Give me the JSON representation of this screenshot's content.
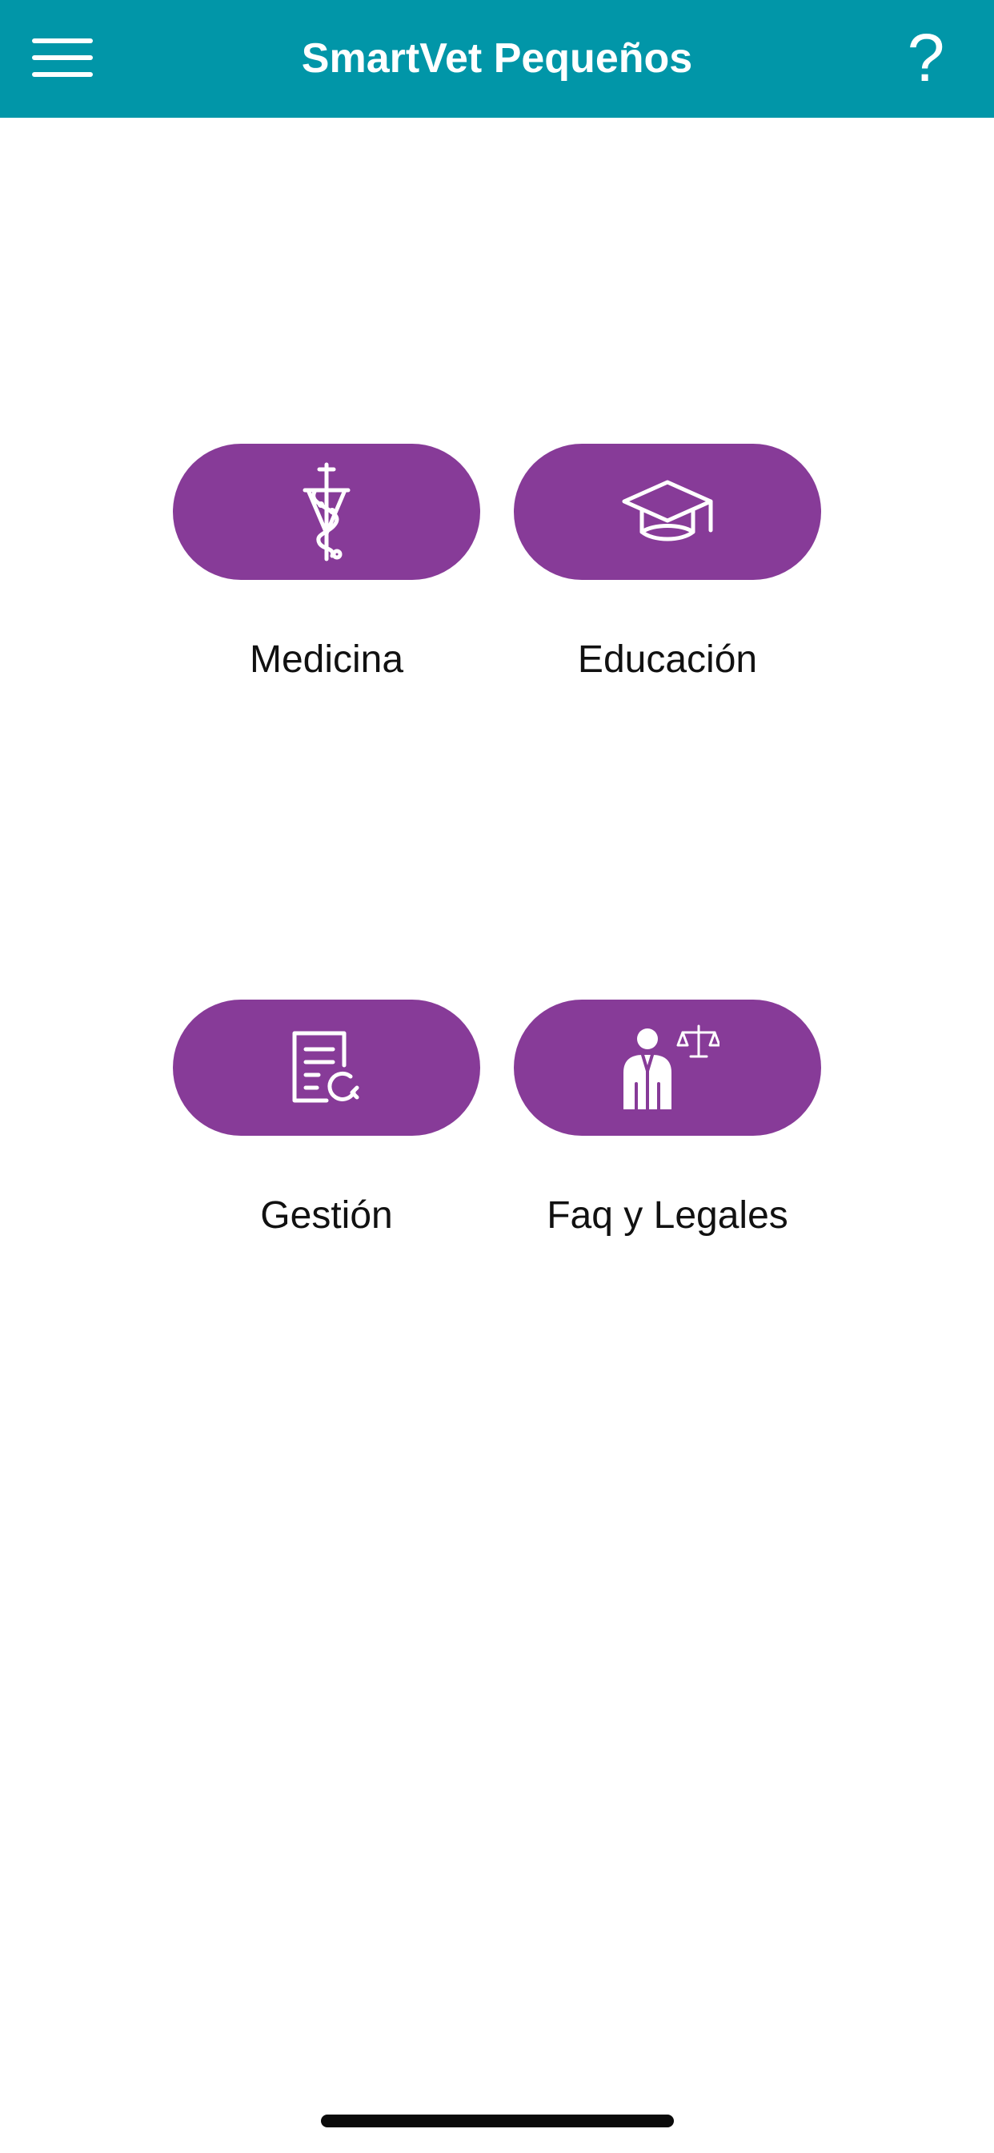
{
  "header": {
    "title": "SmartVet Pequeños",
    "help_label": "?",
    "background_color": "#0196a8"
  },
  "tiles": [
    {
      "label": "Medicina",
      "icon": "caduceus-icon"
    },
    {
      "label": "Educación",
      "icon": "graduation-cap-icon"
    },
    {
      "label": "Gestión",
      "icon": "document-search-icon"
    },
    {
      "label": "Faq y Legales",
      "icon": "lawyer-scales-icon"
    }
  ],
  "colors": {
    "tile": "#873b98",
    "text": "#111111"
  }
}
